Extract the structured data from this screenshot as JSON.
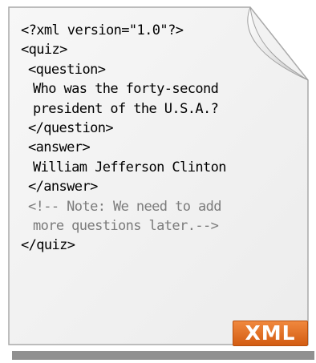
{
  "document": {
    "lines": [
      {
        "text": "<?xml version=\"1.0\"?>",
        "indent": 0
      },
      {
        "text": "<quiz>",
        "indent": 0
      },
      {
        "text": "<question>",
        "indent": 1
      },
      {
        "text": "Who was the forty-second",
        "indent": 2
      },
      {
        "text": "president of the U.S.A.?",
        "indent": 2
      },
      {
        "text": "</question>",
        "indent": 1
      },
      {
        "text": "<answer>",
        "indent": 1
      },
      {
        "text": "William Jefferson Clinton",
        "indent": 2
      },
      {
        "text": "</answer>",
        "indent": 1
      },
      {
        "text": "<!-- Note: We need to add",
        "indent": 1,
        "comment": true
      },
      {
        "text": "more questions later.-->",
        "indent": 2,
        "comment": true
      },
      {
        "text": "</quiz>",
        "indent": 0
      }
    ]
  },
  "badge": {
    "label": "XML",
    "color": "#e26d1e"
  },
  "colors": {
    "paper": "#f2f2f2",
    "comment": "#7b7b7b",
    "shadow": "#909090"
  }
}
